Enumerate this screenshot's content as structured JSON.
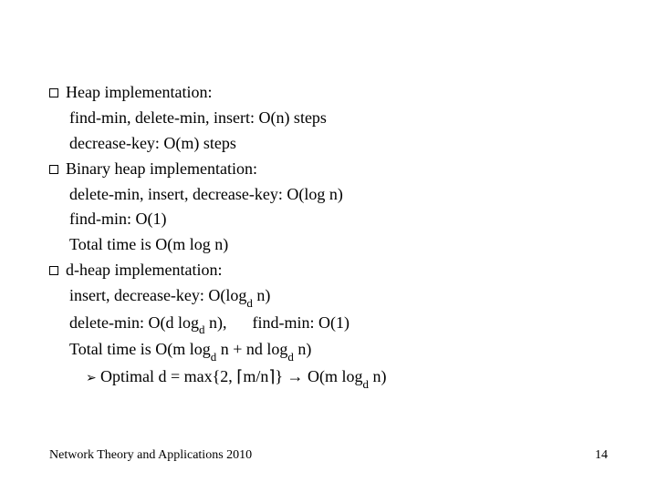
{
  "slide": {
    "bullets": [
      {
        "heading": "Heap implementation:",
        "lines": [
          "find-min, delete-min, insert:   O(n) steps",
          "decrease-key:  O(m) steps"
        ]
      },
      {
        "heading": "Binary heap implementation:",
        "lines": [
          "delete-min, insert, decrease-key:  O(log n)",
          "find-min:  O(1)",
          "Total time is O(m log n)"
        ]
      },
      {
        "heading": "d-heap implementation:",
        "lines": []
      }
    ],
    "dheap": {
      "line1_pre": "insert, decrease-key:  O(log",
      "line1_post": " n)",
      "line2_a_pre": "delete-min:  O(d log",
      "line2_a_post": " n),",
      "line2_b": "find-min:  O(1)",
      "line3_pre": "Total time is  O(m log",
      "line3_mid": " n + nd log",
      "line3_post": " n)",
      "opt_pre": "Optimal d = max{2, ",
      "opt_ratio": "m/n",
      "opt_mid": "}   →  O(m log",
      "opt_post": " n)",
      "sub": "d"
    }
  },
  "footer": {
    "left": "Network Theory and Applications 2010",
    "page": "14"
  }
}
